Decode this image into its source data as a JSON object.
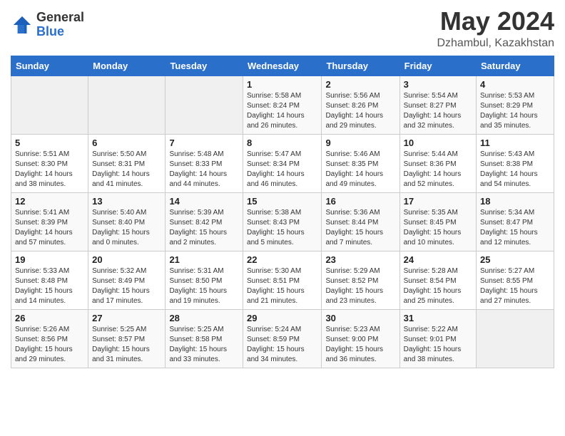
{
  "header": {
    "logo_general": "General",
    "logo_blue": "Blue",
    "title": "May 2024",
    "subtitle": "Dzhambul, Kazakhstan"
  },
  "calendar": {
    "days_of_week": [
      "Sunday",
      "Monday",
      "Tuesday",
      "Wednesday",
      "Thursday",
      "Friday",
      "Saturday"
    ],
    "weeks": [
      [
        {
          "day": "",
          "info": ""
        },
        {
          "day": "",
          "info": ""
        },
        {
          "day": "",
          "info": ""
        },
        {
          "day": "1",
          "info": "Sunrise: 5:58 AM\nSunset: 8:24 PM\nDaylight: 14 hours\nand 26 minutes."
        },
        {
          "day": "2",
          "info": "Sunrise: 5:56 AM\nSunset: 8:26 PM\nDaylight: 14 hours\nand 29 minutes."
        },
        {
          "day": "3",
          "info": "Sunrise: 5:54 AM\nSunset: 8:27 PM\nDaylight: 14 hours\nand 32 minutes."
        },
        {
          "day": "4",
          "info": "Sunrise: 5:53 AM\nSunset: 8:29 PM\nDaylight: 14 hours\nand 35 minutes."
        }
      ],
      [
        {
          "day": "5",
          "info": "Sunrise: 5:51 AM\nSunset: 8:30 PM\nDaylight: 14 hours\nand 38 minutes."
        },
        {
          "day": "6",
          "info": "Sunrise: 5:50 AM\nSunset: 8:31 PM\nDaylight: 14 hours\nand 41 minutes."
        },
        {
          "day": "7",
          "info": "Sunrise: 5:48 AM\nSunset: 8:33 PM\nDaylight: 14 hours\nand 44 minutes."
        },
        {
          "day": "8",
          "info": "Sunrise: 5:47 AM\nSunset: 8:34 PM\nDaylight: 14 hours\nand 46 minutes."
        },
        {
          "day": "9",
          "info": "Sunrise: 5:46 AM\nSunset: 8:35 PM\nDaylight: 14 hours\nand 49 minutes."
        },
        {
          "day": "10",
          "info": "Sunrise: 5:44 AM\nSunset: 8:36 PM\nDaylight: 14 hours\nand 52 minutes."
        },
        {
          "day": "11",
          "info": "Sunrise: 5:43 AM\nSunset: 8:38 PM\nDaylight: 14 hours\nand 54 minutes."
        }
      ],
      [
        {
          "day": "12",
          "info": "Sunrise: 5:41 AM\nSunset: 8:39 PM\nDaylight: 14 hours\nand 57 minutes."
        },
        {
          "day": "13",
          "info": "Sunrise: 5:40 AM\nSunset: 8:40 PM\nDaylight: 15 hours\nand 0 minutes."
        },
        {
          "day": "14",
          "info": "Sunrise: 5:39 AM\nSunset: 8:42 PM\nDaylight: 15 hours\nand 2 minutes."
        },
        {
          "day": "15",
          "info": "Sunrise: 5:38 AM\nSunset: 8:43 PM\nDaylight: 15 hours\nand 5 minutes."
        },
        {
          "day": "16",
          "info": "Sunrise: 5:36 AM\nSunset: 8:44 PM\nDaylight: 15 hours\nand 7 minutes."
        },
        {
          "day": "17",
          "info": "Sunrise: 5:35 AM\nSunset: 8:45 PM\nDaylight: 15 hours\nand 10 minutes."
        },
        {
          "day": "18",
          "info": "Sunrise: 5:34 AM\nSunset: 8:47 PM\nDaylight: 15 hours\nand 12 minutes."
        }
      ],
      [
        {
          "day": "19",
          "info": "Sunrise: 5:33 AM\nSunset: 8:48 PM\nDaylight: 15 hours\nand 14 minutes."
        },
        {
          "day": "20",
          "info": "Sunrise: 5:32 AM\nSunset: 8:49 PM\nDaylight: 15 hours\nand 17 minutes."
        },
        {
          "day": "21",
          "info": "Sunrise: 5:31 AM\nSunset: 8:50 PM\nDaylight: 15 hours\nand 19 minutes."
        },
        {
          "day": "22",
          "info": "Sunrise: 5:30 AM\nSunset: 8:51 PM\nDaylight: 15 hours\nand 21 minutes."
        },
        {
          "day": "23",
          "info": "Sunrise: 5:29 AM\nSunset: 8:52 PM\nDaylight: 15 hours\nand 23 minutes."
        },
        {
          "day": "24",
          "info": "Sunrise: 5:28 AM\nSunset: 8:54 PM\nDaylight: 15 hours\nand 25 minutes."
        },
        {
          "day": "25",
          "info": "Sunrise: 5:27 AM\nSunset: 8:55 PM\nDaylight: 15 hours\nand 27 minutes."
        }
      ],
      [
        {
          "day": "26",
          "info": "Sunrise: 5:26 AM\nSunset: 8:56 PM\nDaylight: 15 hours\nand 29 minutes."
        },
        {
          "day": "27",
          "info": "Sunrise: 5:25 AM\nSunset: 8:57 PM\nDaylight: 15 hours\nand 31 minutes."
        },
        {
          "day": "28",
          "info": "Sunrise: 5:25 AM\nSunset: 8:58 PM\nDaylight: 15 hours\nand 33 minutes."
        },
        {
          "day": "29",
          "info": "Sunrise: 5:24 AM\nSunset: 8:59 PM\nDaylight: 15 hours\nand 34 minutes."
        },
        {
          "day": "30",
          "info": "Sunrise: 5:23 AM\nSunset: 9:00 PM\nDaylight: 15 hours\nand 36 minutes."
        },
        {
          "day": "31",
          "info": "Sunrise: 5:22 AM\nSunset: 9:01 PM\nDaylight: 15 hours\nand 38 minutes."
        },
        {
          "day": "",
          "info": ""
        }
      ]
    ]
  }
}
